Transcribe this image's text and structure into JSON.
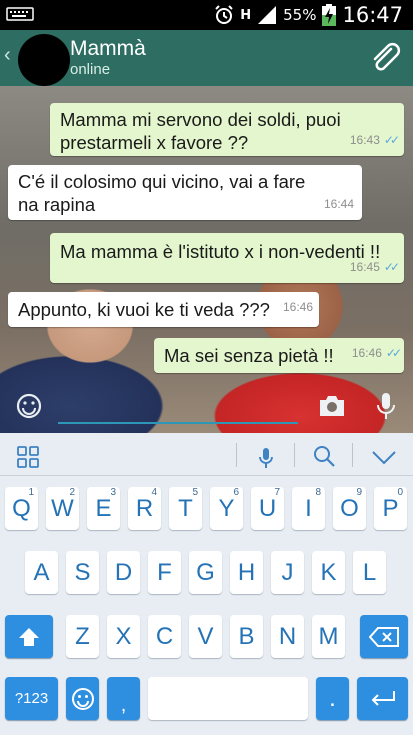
{
  "status_bar": {
    "battery_percent": "55%",
    "time": "16:47",
    "network_label": "H"
  },
  "header": {
    "name": "Mammà",
    "status": "online"
  },
  "messages": [
    {
      "direction": "out",
      "text": "Mamma mi servono dei soldi,  puoi prestarmeli x favore ??",
      "time": "16:43",
      "read": true
    },
    {
      "direction": "in",
      "text": "C'é il colosimo qui vicino, vai a fare na rapina",
      "time": "16:44"
    },
    {
      "direction": "out",
      "text": "Ma mamma è l'istituto x i non-vedenti !!",
      "time": "16:45",
      "read": true
    },
    {
      "direction": "in",
      "text": "Appunto, ki vuoi ke ti veda ???",
      "time": "16:46"
    },
    {
      "direction": "out",
      "text": "Ma sei senza pietà !!",
      "time": "16:46",
      "read": true
    }
  ],
  "input": {
    "placeholder": ""
  },
  "keyboard": {
    "row1": [
      {
        "label": "Q",
        "sup": "1"
      },
      {
        "label": "W",
        "sup": "2"
      },
      {
        "label": "E",
        "sup": "3"
      },
      {
        "label": "R",
        "sup": "4"
      },
      {
        "label": "T",
        "sup": "5"
      },
      {
        "label": "Y",
        "sup": "6"
      },
      {
        "label": "U",
        "sup": "7"
      },
      {
        "label": "I",
        "sup": "8"
      },
      {
        "label": "O",
        "sup": "9"
      },
      {
        "label": "P",
        "sup": "0"
      }
    ],
    "row2": [
      "A",
      "S",
      "D",
      "F",
      "G",
      "H",
      "J",
      "K",
      "L"
    ],
    "row3": [
      "Z",
      "X",
      "C",
      "V",
      "B",
      "N",
      "M"
    ],
    "symbols_label": "?123",
    "dot_label": "."
  },
  "colors": {
    "header": "#2e6e62",
    "outgoing_bubble": "#e4f6cd",
    "key_accent": "#2e8fe0"
  }
}
